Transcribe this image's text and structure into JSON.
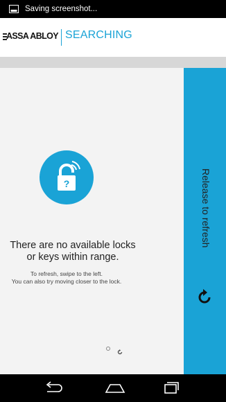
{
  "status_bar": {
    "icon": "screenshot-notification-icon",
    "text": "Saving screenshot..."
  },
  "app_bar": {
    "menu_icon": "hamburger-menu-icon",
    "logo_text": "ASSA ABLOY",
    "title": "SEARCHING"
  },
  "content": {
    "lock_icon": "lock-question-wireless-icon",
    "lock_badge": "?",
    "message_line1": "There are no available locks",
    "message_line2": "or keys within range.",
    "hint_line1": "To refresh, swipe to the left.",
    "hint_line2": "You can also try moving closer to the lock.",
    "pager": {
      "dot_icon": "page-dot-icon",
      "refresh_icon": "small-refresh-icon"
    }
  },
  "refresh_panel": {
    "text": "Release to refresh",
    "icon": "refresh-arrow-icon"
  },
  "nav_bar": {
    "back_icon": "back-icon",
    "home_icon": "home-icon",
    "recents_icon": "recents-icon"
  },
  "colors": {
    "accent": "#1aa3d6",
    "content_bg": "#f3f3f3",
    "strip": "#d7d7d7",
    "bars": "#000000"
  }
}
